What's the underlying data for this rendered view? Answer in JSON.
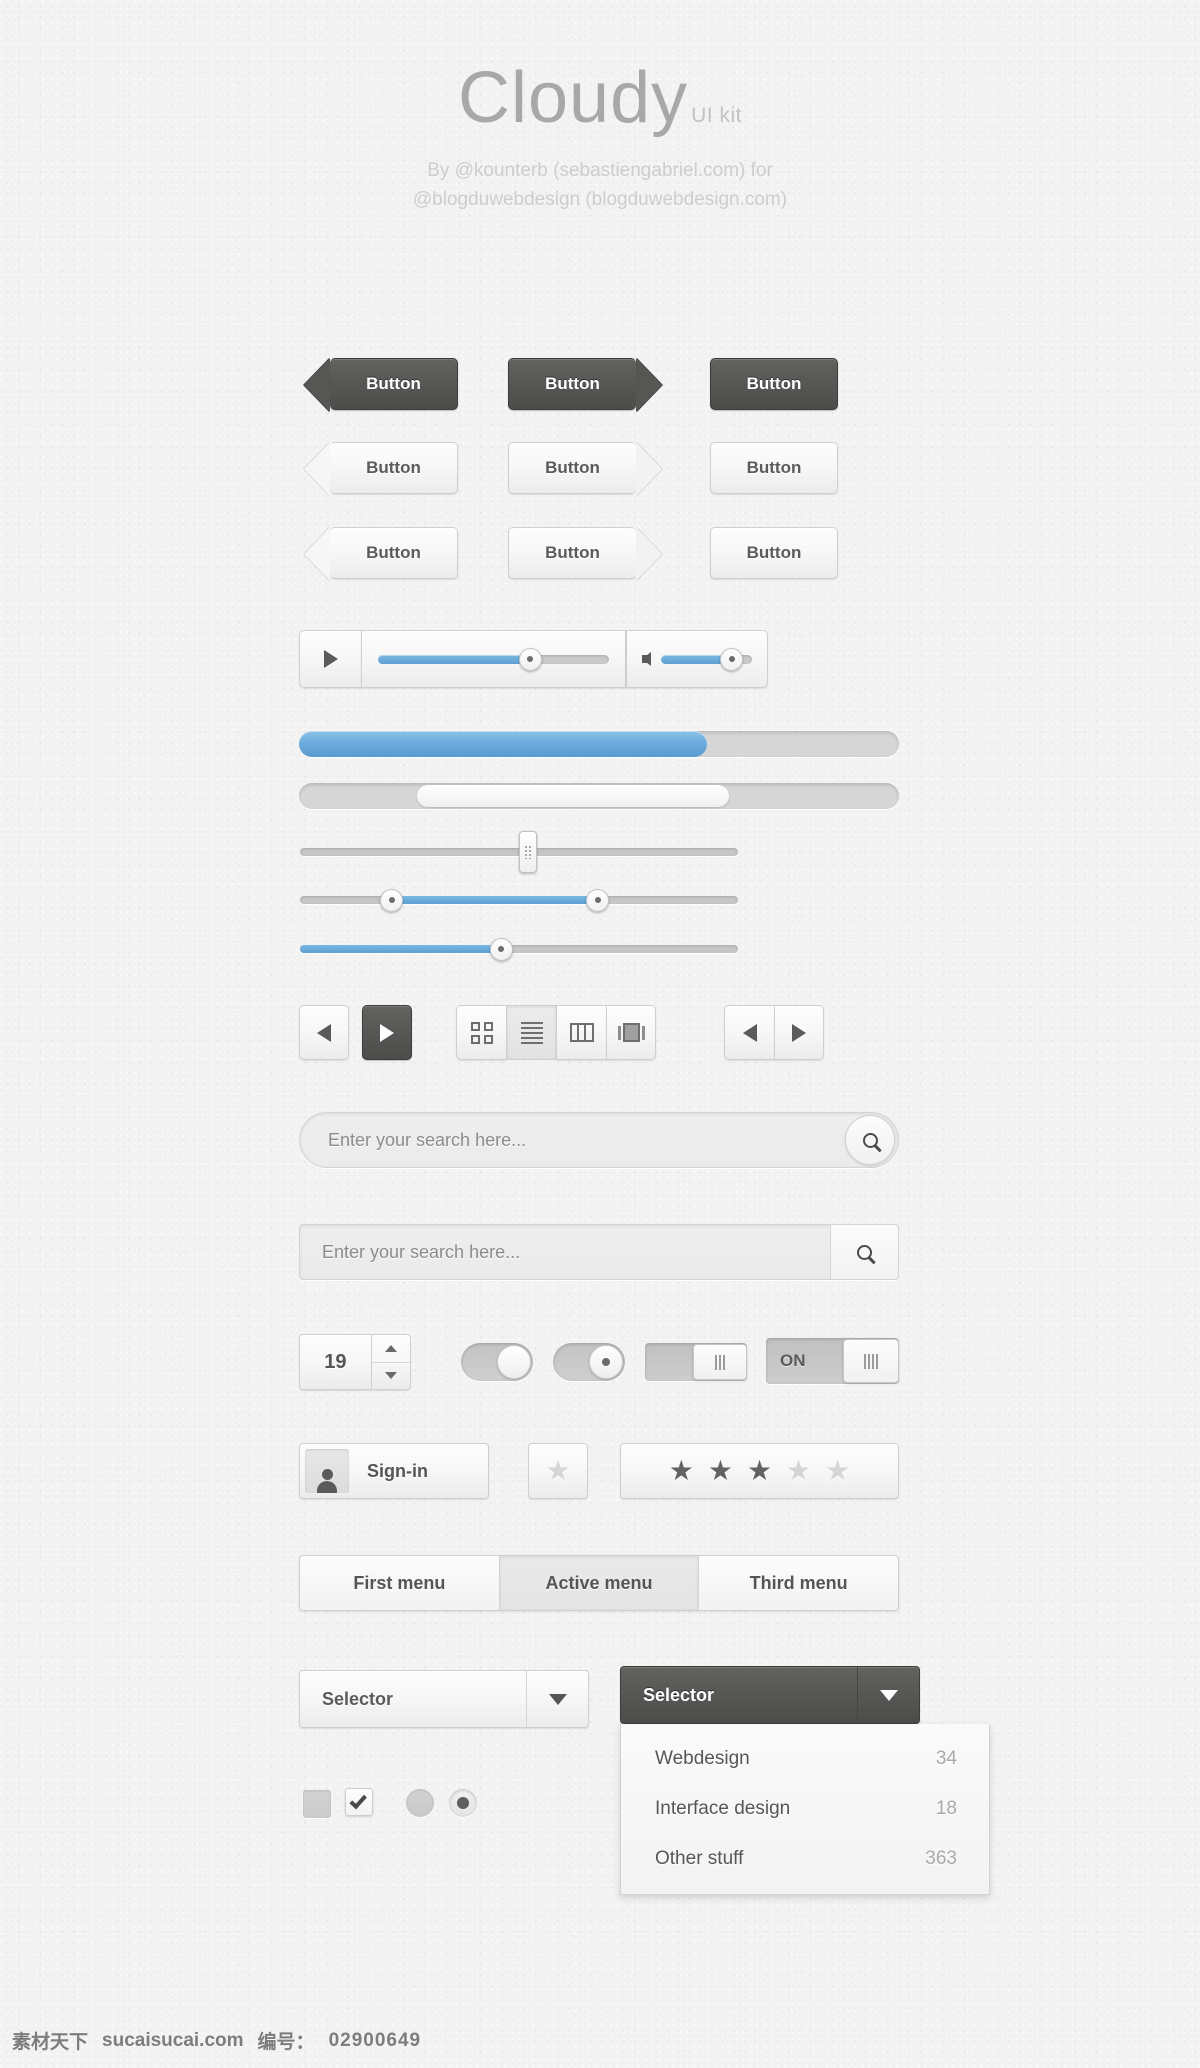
{
  "header": {
    "title": "Cloudy",
    "subtitle": "UI kit",
    "credit_line1": "By @kounterb (sebastiengabriel.com) for",
    "credit_line2": "@blogduwebdesign (blogduwebdesign.com)"
  },
  "buttons": {
    "row1": [
      {
        "label": "Button",
        "style": "dark",
        "shape": "arrow-left"
      },
      {
        "label": "Button",
        "style": "dark",
        "shape": "arrow-right"
      },
      {
        "label": "Button",
        "style": "dark",
        "shape": "rect"
      }
    ],
    "row2": [
      {
        "label": "Button",
        "style": "light",
        "shape": "arrow-left"
      },
      {
        "label": "Button",
        "style": "light",
        "shape": "arrow-right"
      },
      {
        "label": "Button",
        "style": "light",
        "shape": "rect"
      }
    ],
    "row3": [
      {
        "label": "Button",
        "style": "light",
        "shape": "arrow-left"
      },
      {
        "label": "Button",
        "style": "light",
        "shape": "arrow-right"
      },
      {
        "label": "Button",
        "style": "light",
        "shape": "rect"
      }
    ]
  },
  "player": {
    "play_icon": "play-icon",
    "volume_icon": "speaker-icon",
    "progress_percent": 66,
    "volume_percent": 78
  },
  "progress_bars": [
    {
      "name": "progress-bar-blue",
      "percent": 68
    },
    {
      "name": "progress-bar-pill",
      "percent": 72
    }
  ],
  "sliders": [
    {
      "name": "slider-grip",
      "value_percent": 52,
      "fill_percent": 0,
      "handle": "grip"
    },
    {
      "name": "slider-range",
      "low_percent": 21,
      "high_percent": 68,
      "handle": "dual-round"
    },
    {
      "name": "slider-single",
      "value_percent": 46,
      "handle": "round"
    }
  ],
  "toolbar": {
    "nav_left": [
      {
        "icon": "arrow-left-icon",
        "active": false
      },
      {
        "icon": "arrow-right-icon",
        "active": true
      }
    ],
    "views": [
      {
        "icon": "grid-view-icon",
        "active": false
      },
      {
        "icon": "list-view-icon",
        "active": true
      },
      {
        "icon": "column-view-icon",
        "active": false
      },
      {
        "icon": "coverflow-view-icon",
        "active": false
      }
    ],
    "nav_right": [
      {
        "icon": "arrow-left-icon",
        "active": false
      },
      {
        "icon": "arrow-right-icon",
        "active": false
      }
    ]
  },
  "search": {
    "rounded_placeholder": "Enter your search here...",
    "square_placeholder": "Enter your search here...",
    "button_icon": "search-icon"
  },
  "stepper": {
    "value": "19",
    "up_icon": "caret-up-icon",
    "down_icon": "caret-down-icon"
  },
  "toggles": [
    {
      "name": "toggle-plain",
      "state": "off",
      "label": ""
    },
    {
      "name": "toggle-dot",
      "state": "off",
      "label": ""
    },
    {
      "name": "toggle-square",
      "state": "off",
      "label": ""
    },
    {
      "name": "toggle-on",
      "state": "on",
      "label": "ON"
    }
  ],
  "signin": {
    "label": "Sign-in",
    "icon": "user-icon"
  },
  "rating": {
    "single_star": {
      "filled": false
    },
    "stars_filled": 3,
    "stars_total": 5,
    "glyph": "★"
  },
  "menu_tabs": [
    {
      "label": "First menu",
      "active": false
    },
    {
      "label": "Active menu",
      "active": true
    },
    {
      "label": "Third menu",
      "active": false
    }
  ],
  "selectors": {
    "light": {
      "label": "Selector",
      "caret_icon": "caret-down-icon"
    },
    "dark": {
      "label": "Selector",
      "caret_icon": "caret-down-icon"
    }
  },
  "dropdown": {
    "items": [
      {
        "label": "Webdesign",
        "count": "34"
      },
      {
        "label": "Interface design",
        "count": "18"
      },
      {
        "label": "Other stuff",
        "count": "363"
      }
    ]
  },
  "choices": [
    {
      "name": "checkbox-unchecked",
      "type": "checkbox",
      "checked": false
    },
    {
      "name": "checkbox-checked",
      "type": "checkbox",
      "checked": true
    },
    {
      "name": "radio-unselected",
      "type": "radio",
      "selected": false
    },
    {
      "name": "radio-selected",
      "type": "radio",
      "selected": true
    }
  ],
  "footer": {
    "site_cn": "素材天下",
    "site_url": "sucaisucai.com",
    "id_label": "编号：",
    "id_value": "02900649"
  },
  "colors": {
    "accent_blue": "#6aabdc",
    "dark_button": "#565654",
    "page_bg": "#f2f2f2",
    "text_dark": "#555555",
    "text_muted": "#8b8b8b"
  }
}
